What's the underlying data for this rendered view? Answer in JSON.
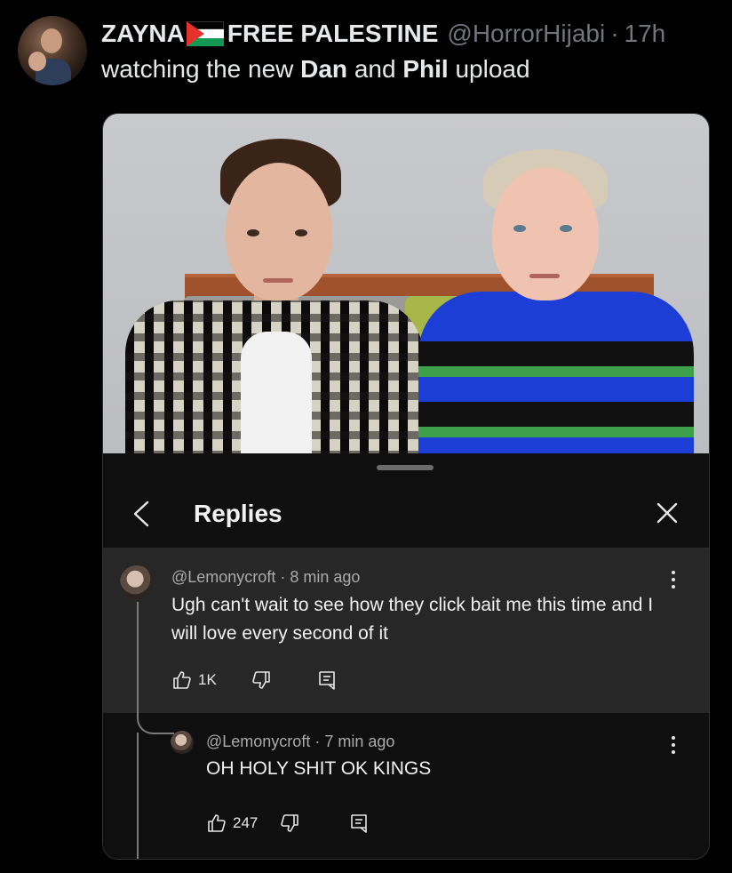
{
  "tweet": {
    "display_name": "ZAYNA",
    "display_name_suffix": "FREE PALESTINE",
    "handle": "@HorrorHijabi",
    "separator": "·",
    "time": "17h",
    "text_parts": [
      "watching the new ",
      "Dan",
      " and ",
      "Phil",
      " upload"
    ]
  },
  "sheet": {
    "title": "Replies"
  },
  "comment": {
    "author": "@Lemonycroft",
    "time": "8 min ago",
    "text": "Ugh can't wait to see how they click bait me this time and I will love every second of it",
    "likes": "1K"
  },
  "reply": {
    "author": "@Lemonycroft",
    "time": "7 min ago",
    "text": "OH HOLY SHIT OK KINGS",
    "likes": "247"
  },
  "colors": {
    "background": "#000000",
    "sheet_bg": "#0f0f0f",
    "comment_bg": "#272727",
    "muted": "#71767b",
    "flag_red": "#e4312b",
    "flag_green": "#149954"
  }
}
